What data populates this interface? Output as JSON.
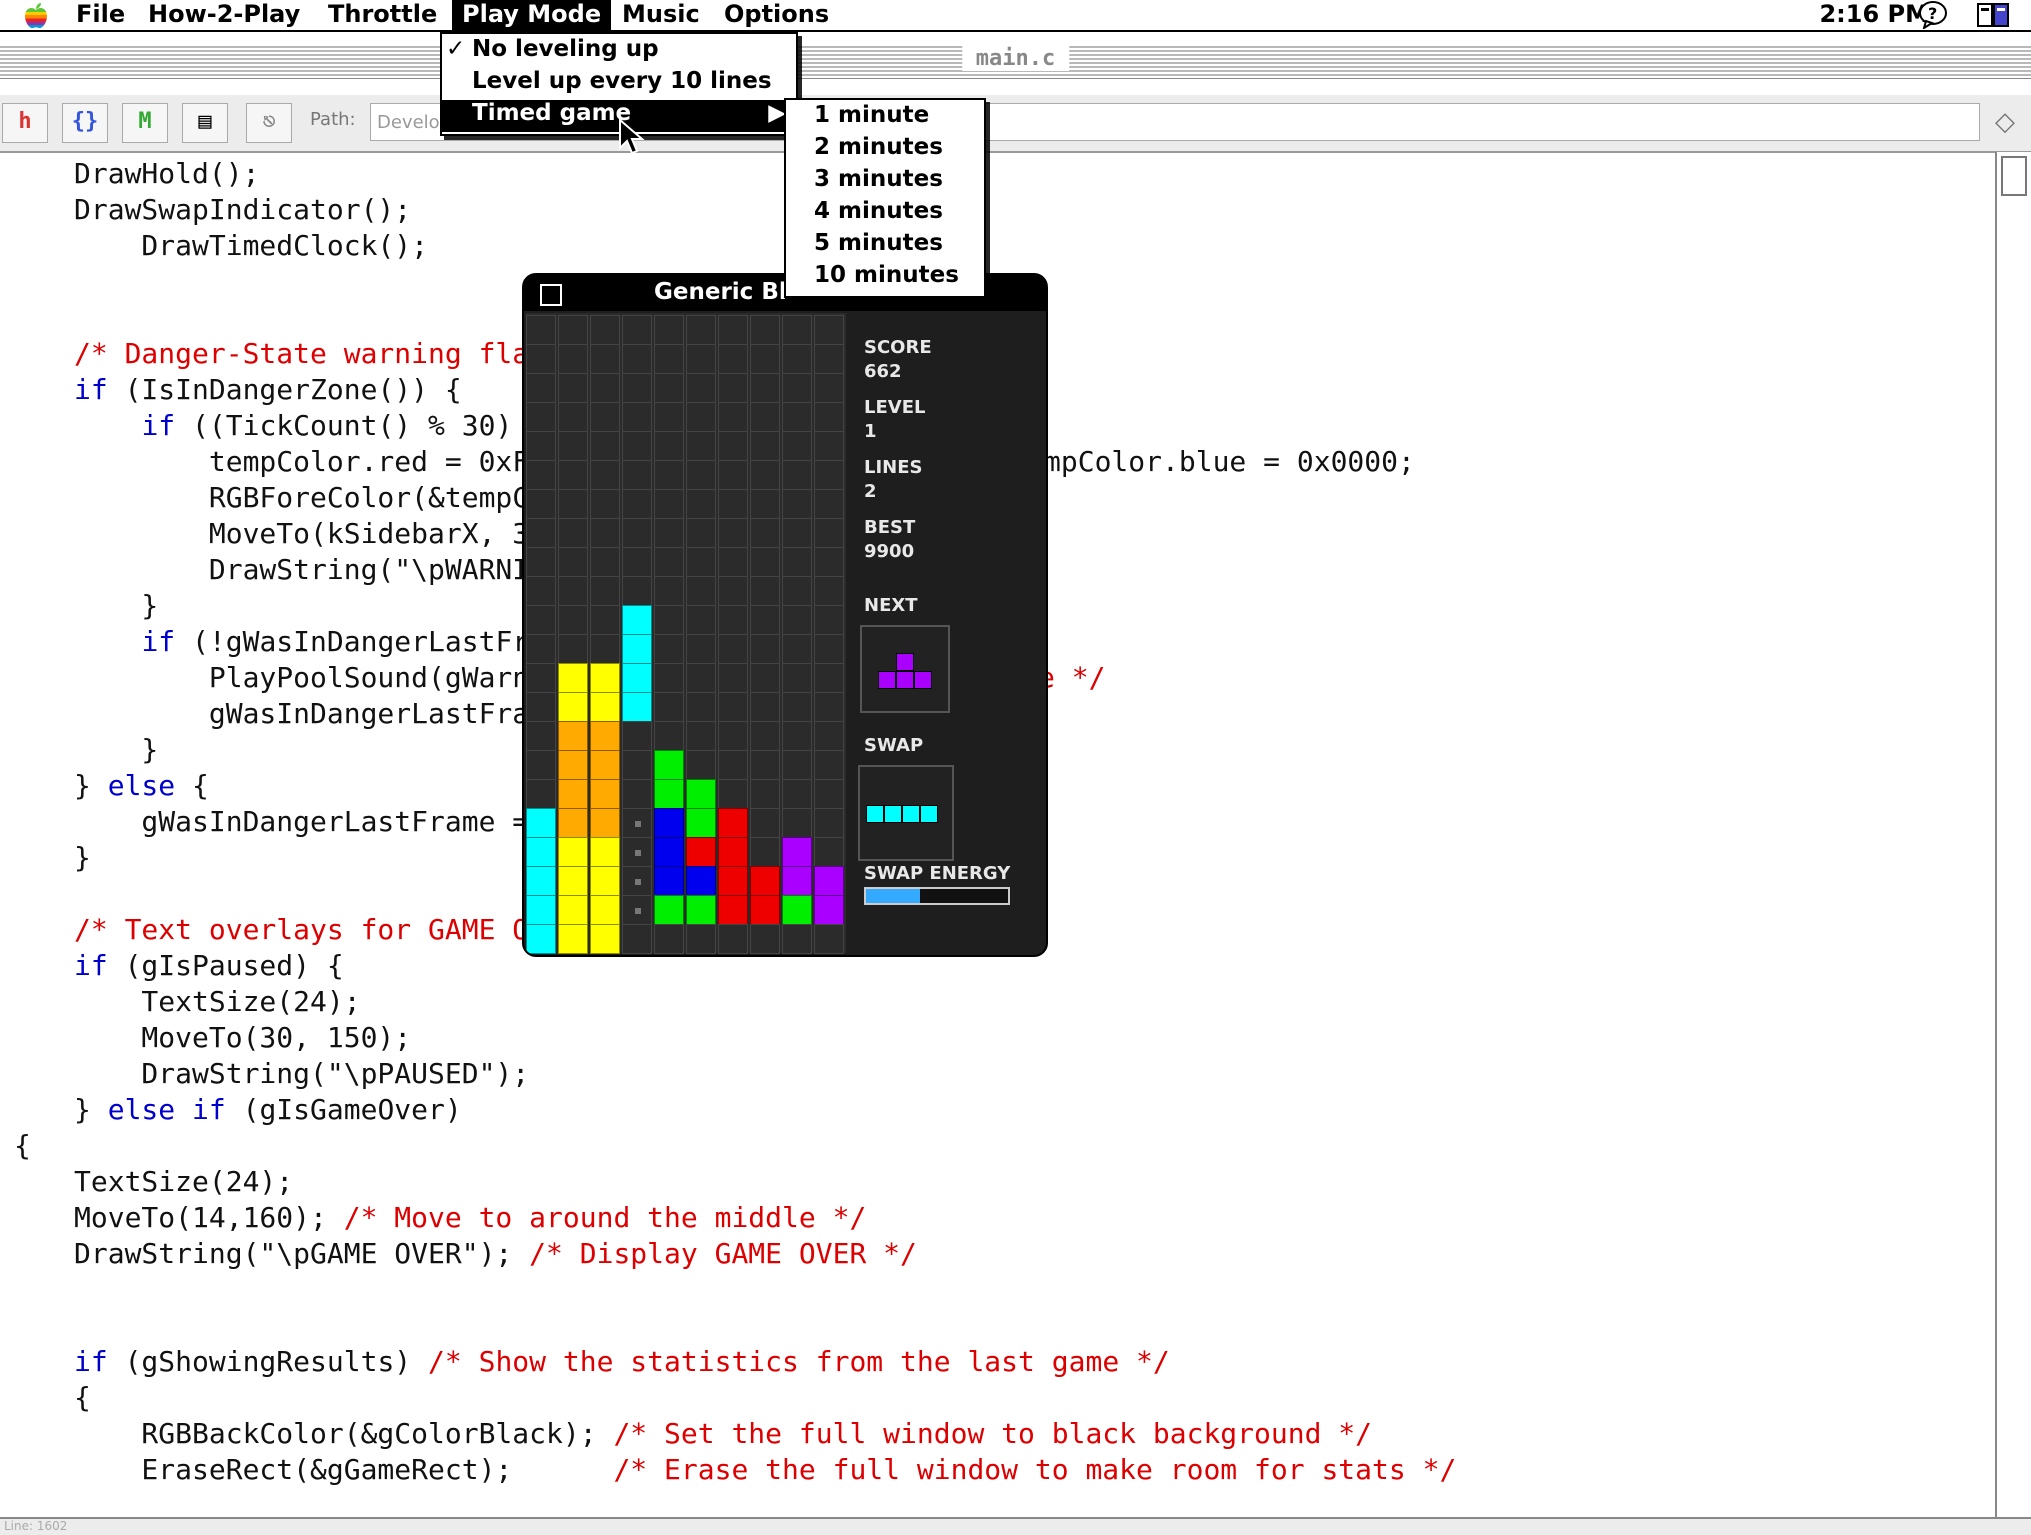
{
  "menubar": {
    "items": [
      "File",
      "How-2-Play",
      "Throttle",
      "Play Mode",
      "Music",
      "Options"
    ],
    "clock": "2:16 PM"
  },
  "editor": {
    "window_title": "main.c",
    "path_label": "Path:",
    "path_value": "Develo",
    "status_text": "Line: 1602",
    "lines": [
      [
        [
          "",
          "DrawHold();"
        ]
      ],
      [
        [
          "",
          "DrawSwapIndicator();"
        ]
      ],
      [
        [
          "",
          "    DrawTimedClock();"
        ]
      ],
      [],
      [],
      [
        [
          "cm",
          "/* Danger-State warning flas"
        ]
      ],
      [
        [
          "kw",
          "if"
        ],
        [
          "",
          " (IsInDangerZone()) {"
        ]
      ],
      [
        [
          "",
          "    "
        ],
        [
          "kw",
          "if"
        ],
        [
          "",
          " ((TickCount() % 30) <"
        ]
      ],
      [
        [
          "",
          "        tempColor.red = 0xFF"
        ]
      ],
      [
        [
          "",
          "        RGBForeColor(&tempCo"
        ]
      ],
      [
        [
          "",
          "        MoveTo(kSidebarX, 31"
        ]
      ],
      [
        [
          "",
          "        DrawString(\"\\pWARNIN"
        ]
      ],
      [
        [
          "",
          "    }"
        ]
      ],
      [
        [
          "",
          "    "
        ],
        [
          "kw",
          "if"
        ],
        [
          "",
          " (!gWasInDangerLastFra"
        ]
      ],
      [
        [
          "",
          "        PlayPoolSound(gWarni"
        ]
      ],
      [
        [
          "",
          "        gWasInDangerLastFram"
        ]
      ],
      [
        [
          "",
          "    }"
        ]
      ],
      [
        [
          "",
          "} "
        ],
        [
          "kw",
          "else"
        ],
        [
          "",
          " {"
        ]
      ],
      [
        [
          "",
          "    gWasInDangerLastFrame = "
        ]
      ],
      [
        [
          "",
          "}"
        ]
      ],
      [],
      [
        [
          "cm",
          "/* Text overlays for GAME OV"
        ]
      ],
      [
        [
          "kw",
          "if"
        ],
        [
          "",
          " (gIsPaused) {"
        ]
      ],
      [
        [
          "",
          "    TextSize(24);"
        ]
      ],
      [
        [
          "",
          "    MoveTo(30, 150);"
        ]
      ],
      [
        [
          "",
          "    DrawString(\"\\pPAUSED\");"
        ]
      ],
      [
        [
          "",
          "} "
        ],
        [
          "kw",
          "else if"
        ],
        [
          "",
          " (gIsGameOver)"
        ]
      ],
      [
        [
          "",
          "{"
        ]
      ],
      [
        [
          "",
          "TextSize(24);"
        ]
      ],
      [
        [
          "",
          "MoveTo(14,160); "
        ],
        [
          "cm",
          "/* Move to around the middle */"
        ]
      ],
      [
        [
          "",
          "DrawString(\"\\pGAME OVER\"); "
        ],
        [
          "cm",
          "/* Display GAME OVER */"
        ]
      ],
      [],
      [],
      [
        [
          "kw",
          "if"
        ],
        [
          "",
          " (gShowingResults) "
        ],
        [
          "cm",
          "/* Show the statistics from the last game */"
        ]
      ],
      [
        [
          "",
          "{"
        ]
      ],
      [
        [
          "",
          "    RGBBackColor(&gColorBlack); "
        ],
        [
          "cm",
          "/* Set the full window to black background */"
        ]
      ],
      [
        [
          "",
          "    EraseRect(&gGameRect);      "
        ],
        [
          "cm",
          "/* Erase the full window to make room for stats */"
        ]
      ]
    ],
    "hidden_fragments": [
      {
        "text": "mpColor.blue = 0x0000;",
        "line": 8
      },
      {
        "text": "e */",
        "line": 14
      }
    ]
  },
  "game": {
    "title": "Generic Bl",
    "score_label": "SCORE",
    "score": "662",
    "level_label": "LEVEL",
    "level": "1",
    "lines_label": "LINES",
    "lines": "2",
    "best_label": "BEST",
    "best": "9900",
    "next_label": "NEXT",
    "swap_label": "SWAP",
    "swap_energy_label": "SWAP ENERGY",
    "swap_energy_fraction": 0.38,
    "next_piece": "T",
    "swap_piece": "I",
    "colors": {
      "cyan": "#00ffff",
      "yellow": "#ffff00",
      "orange": "#ffaa00",
      "green": "#00ee00",
      "blue": "#0000ee",
      "red": "#ee0000",
      "purple": "#aa00ff",
      "empty": "#2b2b2b"
    },
    "board_rows": [
      "..........",
      "..........",
      "..........",
      "..........",
      "..........",
      "..........",
      "..........",
      "..........",
      "..........",
      "..........",
      "...C......",
      "...C......",
      ".YYC......",
      ".YYC......",
      ".OO.......",
      ".OO.G.....",
      ".OO.GG....",
      "COO.BGR...",
      "CYY.BRR.P.",
      "CYY.BBRRPP",
      "CYY.GGRRGP",
      "CYY......."
    ],
    "dots_rows": [
      17,
      18,
      19,
      20
    ]
  },
  "menus": {
    "play_mode": {
      "items": [
        "No leveling up",
        "Level up every 10 lines",
        "Timed game"
      ],
      "checked_index": 0,
      "highlighted_index": 2
    },
    "timed_submenu": {
      "items": [
        "1 minute",
        "2 minutes",
        "3 minutes",
        "4 minutes",
        "5 minutes",
        "10 minutes"
      ]
    }
  }
}
